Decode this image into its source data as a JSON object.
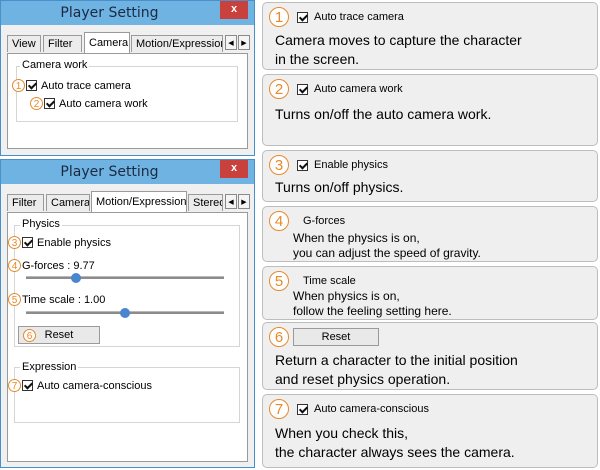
{
  "window1": {
    "title": "Player Setting",
    "close": "x",
    "tabs": [
      "View",
      "Filter",
      "Camera",
      "Motion/Expression"
    ],
    "active_tab": "Camera",
    "group_title": "Camera work",
    "items": [
      {
        "num": "1",
        "label": "Auto trace camera",
        "checked": true
      },
      {
        "num": "2",
        "label": "Auto camera work",
        "checked": true
      }
    ]
  },
  "window2": {
    "title": "Player Setting",
    "close": "x",
    "tabs": [
      "Filter",
      "Camera",
      "Motion/Expression",
      "Stereo"
    ],
    "active_tab": "Motion/Expression",
    "physics_group": "Physics",
    "enable_physics": {
      "num": "3",
      "label": "Enable physics",
      "checked": true
    },
    "gforces": {
      "num": "4",
      "label": "G-forces : 9.77",
      "level": 0.25
    },
    "timescale": {
      "num": "5",
      "label": "Time scale : 1.00",
      "level": 0.5
    },
    "reset": {
      "num": "6",
      "label": "Reset"
    },
    "expression_group": "Expression",
    "camera_conscious": {
      "num": "7",
      "label": "Auto camera-conscious",
      "checked": true
    }
  },
  "cards": [
    {
      "num": "1",
      "header": "Auto trace camera",
      "lines": [
        "Camera moves to capture the character",
        "in the screen."
      ]
    },
    {
      "num": "2",
      "header": "Auto camera work",
      "lines": [
        "Turns on/off the auto camera work."
      ]
    },
    {
      "num": "3",
      "header": "Enable physics",
      "lines": [
        "Turns on/off physics."
      ]
    },
    {
      "num": "4",
      "header": "G-forces",
      "lines": [
        "When the physics is on,",
        "you can adjust the speed of gravity."
      ]
    },
    {
      "num": "5",
      "header": "Time scale",
      "lines": [
        "When physics is on,",
        "follow the feeling setting here."
      ]
    },
    {
      "num": "6",
      "header": "Reset",
      "lines": [
        "Return a character to the initial position",
        "and reset physics operation."
      ]
    },
    {
      "num": "7",
      "header": "Auto camera-conscious",
      "lines": [
        "When you check this,",
        "the character always sees the camera."
      ]
    }
  ]
}
